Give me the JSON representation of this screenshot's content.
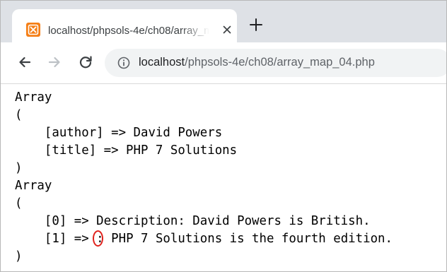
{
  "browser": {
    "tab": {
      "title": "localhost/phpsols-4e/ch08/array_map_04.php",
      "favicon": "xampp-icon",
      "close": "close-icon"
    },
    "new_tab_icon": "plus-icon",
    "nav": {
      "back": "arrow-left-icon",
      "forward": "arrow-right-icon",
      "reload": "reload-icon"
    },
    "address": {
      "security_icon": "info-icon",
      "host": "localhost",
      "path": "/phpsols-4e/ch08/array_map_04.php"
    }
  },
  "output": {
    "lines": [
      "Array",
      "(",
      "    [author] => David Powers",
      "    [title] => PHP 7 Solutions",
      ")",
      "Array",
      "(",
      "    [0] => Description: David Powers is British.",
      "    [1] => ",
      ")"
    ],
    "line9_colon": ":",
    "line9_rest": " PHP 7 Solutions is the fourth edition.",
    "highlight_color": "#e0201b"
  }
}
